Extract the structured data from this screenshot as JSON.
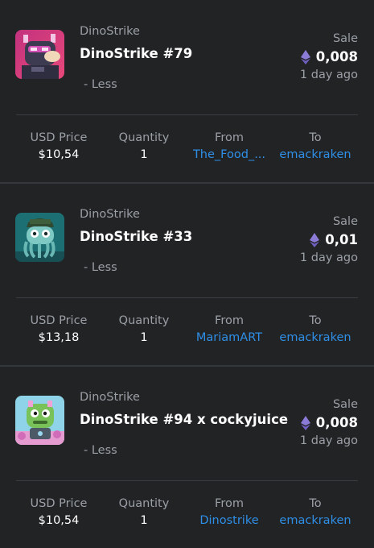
{
  "activities": [
    {
      "collection": "DinoStrike",
      "name": "DinoStrike #79",
      "event_type": "Sale",
      "price": "0,008",
      "time_ago": "1 day ago",
      "toggle": "- Less",
      "thumb_icon": "dino-nft-pink-thumbnail",
      "details": {
        "usd_label": "USD Price",
        "usd_value": "$10,54",
        "qty_label": "Quantity",
        "qty_value": "1",
        "from_label": "From",
        "from_value": "The_Food_...",
        "to_label": "To",
        "to_value": "emackraken"
      }
    },
    {
      "collection": "DinoStrike",
      "name": "DinoStrike #33",
      "event_type": "Sale",
      "price": "0,01",
      "time_ago": "1 day ago",
      "toggle": "- Less",
      "thumb_icon": "dino-nft-teal-thumbnail",
      "details": {
        "usd_label": "USD Price",
        "usd_value": "$13,18",
        "qty_label": "Quantity",
        "qty_value": "1",
        "from_label": "From",
        "from_value": "MariamART",
        "to_label": "To",
        "to_value": "emackraken"
      }
    },
    {
      "collection": "DinoStrike",
      "name": "DinoStrike #94 x cockyjuice",
      "event_type": "Sale",
      "price": "0,008",
      "time_ago": "1 day ago",
      "toggle": "- Less",
      "thumb_icon": "dino-nft-green-thumbnail",
      "details": {
        "usd_label": "USD Price",
        "usd_value": "$10,54",
        "qty_label": "Quantity",
        "qty_value": "1",
        "from_label": "From",
        "from_value": "Dinostrike",
        "to_label": "To",
        "to_value": "emackraken"
      }
    }
  ],
  "colors": {
    "background": "#212325",
    "link": "#2f8fe6",
    "muted_text": "#9b9fa6",
    "eth_icon": "#8c7bd6"
  },
  "icons": {
    "currency": "ethereum-icon"
  }
}
